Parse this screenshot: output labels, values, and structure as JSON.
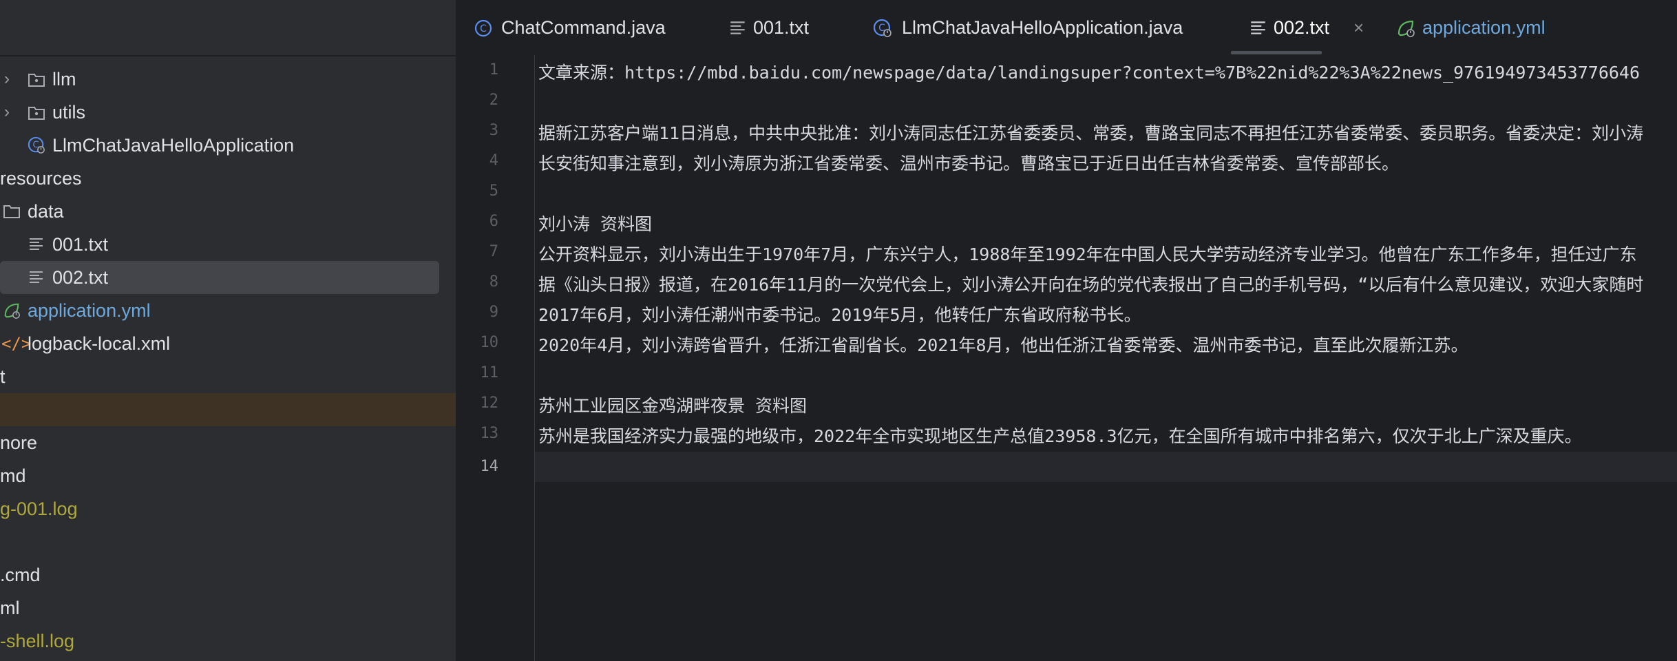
{
  "sidebar": {
    "items": [
      {
        "label": "llm",
        "icon": "folder-package-icon",
        "expandable": true
      },
      {
        "label": "utils",
        "icon": "folder-package-icon",
        "expandable": true
      },
      {
        "label": "LlmChatJavaHelloApplication",
        "icon": "spring-boot-class-icon"
      },
      {
        "label": "resources",
        "icon": ""
      },
      {
        "label": "data",
        "icon": "folder-icon"
      },
      {
        "label": "001.txt",
        "icon": "text-file-icon"
      },
      {
        "label": "002.txt",
        "icon": "text-file-icon",
        "selected": true
      },
      {
        "label": "application.yml",
        "icon": "spring-config-icon"
      },
      {
        "label": "logback-local.xml",
        "icon": "xml-file-icon"
      },
      {
        "label": "t",
        "icon": ""
      },
      {
        "label": "",
        "icon": "",
        "highlighted": true
      },
      {
        "label": "nore",
        "icon": ""
      },
      {
        "label": "md",
        "icon": ""
      },
      {
        "label": "g-001.log",
        "icon": ""
      },
      {
        "label": "",
        "icon": ""
      },
      {
        "label": ".cmd",
        "icon": ""
      },
      {
        "label": "ml",
        "icon": ""
      },
      {
        "label": "-shell.log",
        "icon": ""
      }
    ]
  },
  "tabs": [
    {
      "label": "ChatCommand.java",
      "icon": "java-class-icon"
    },
    {
      "label": "001.txt",
      "icon": "text-file-icon"
    },
    {
      "label": "LlmChatJavaHelloApplication.java",
      "icon": "spring-boot-class-icon"
    },
    {
      "label": "002.txt",
      "icon": "text-file-icon",
      "active": true,
      "close": "×"
    },
    {
      "label": "application.yml",
      "icon": "spring-config-icon"
    }
  ],
  "editor": {
    "current_line": 14,
    "lines": [
      {
        "num": "1",
        "text": "文章来源：https://mbd.baidu.com/newspage/data/landingsuper?context=%7B%22nid%22%3A%22news_976194973453776646"
      },
      {
        "num": "2",
        "text": ""
      },
      {
        "num": "3",
        "text": "据新江苏客户端11日消息，中共中央批准：刘小涛同志任江苏省委委员、常委，曹路宝同志不再担任江苏省委常委、委员职务。省委决定：刘小涛"
      },
      {
        "num": "4",
        "text": "长安街知事注意到，刘小涛原为浙江省委常委、温州市委书记。曹路宝已于近日出任吉林省委常委、宣传部部长。"
      },
      {
        "num": "5",
        "text": ""
      },
      {
        "num": "6",
        "text": "刘小涛 资料图"
      },
      {
        "num": "7",
        "text": "公开资料显示，刘小涛出生于1970年7月，广东兴宁人，1988年至1992年在中国人民大学劳动经济专业学习。他曾在广东工作多年，担任过广东"
      },
      {
        "num": "8",
        "text": "据《汕头日报》报道，在2016年11月的一次党代会上，刘小涛公开向在场的党代表报出了自己的手机号码，“以后有什么意见建议，欢迎大家随时"
      },
      {
        "num": "9",
        "text": "2017年6月，刘小涛任潮州市委书记。2019年5月，他转任广东省政府秘书长。"
      },
      {
        "num": "10",
        "text": "2020年4月，刘小涛跨省晋升，任浙江省副省长。2021年8月，他出任浙江省委常委、温州市委书记，直至此次履新江苏。"
      },
      {
        "num": "11",
        "text": ""
      },
      {
        "num": "12",
        "text": "苏州工业园区金鸡湖畔夜景 资料图"
      },
      {
        "num": "13",
        "text": "苏州是我国经济实力最强的地级市，2022年全市实现地区生产总值23958.3亿元，在全国所有城市中排名第六，仅次于北上广深及重庆。"
      },
      {
        "num": "14",
        "text": ""
      }
    ]
  },
  "colors": {
    "editor_bg": "#1e1f22",
    "sidebar_bg": "#2b2d30",
    "selection_bg": "#43454a",
    "config_blue": "#6fa8dc",
    "log_yellow": "#b0a93a"
  }
}
